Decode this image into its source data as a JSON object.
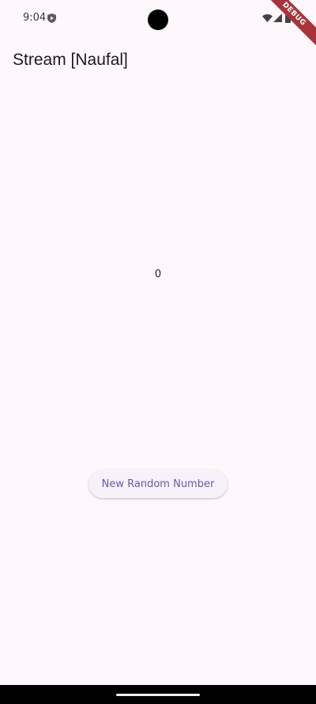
{
  "status_bar": {
    "time": "9:04",
    "icons": [
      "shield-icon",
      "wifi-icon",
      "signal-icon",
      "battery-icon"
    ]
  },
  "debug_banner": {
    "label": "DEBUG",
    "color": "#a8343b"
  },
  "app_bar": {
    "title": "Stream [Naufal]"
  },
  "main": {
    "number": "0",
    "button_label": "New Random Number"
  },
  "colors": {
    "background": "#fef7fb",
    "button_text": "#6b5aa8",
    "button_bg": "#f7f1f9"
  }
}
